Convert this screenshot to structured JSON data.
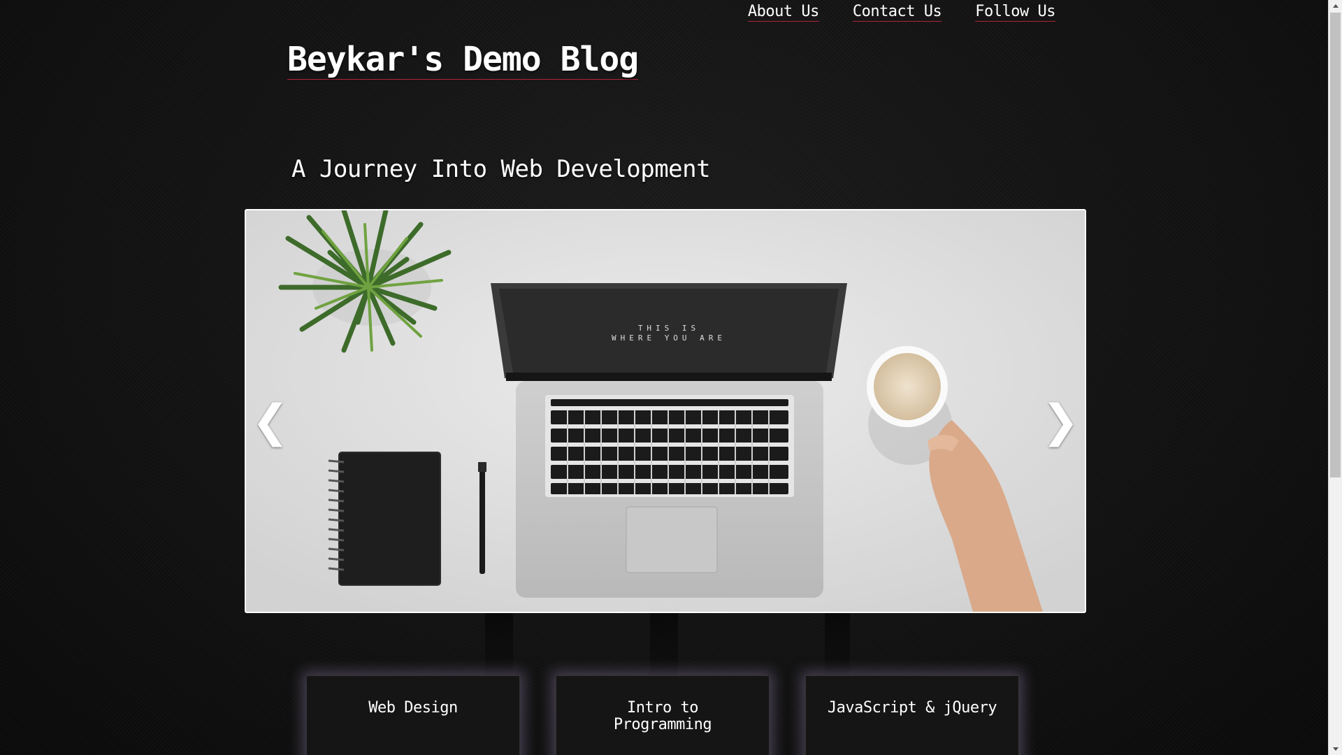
{
  "nav": {
    "items": [
      {
        "label": "About Us"
      },
      {
        "label": "Contact Us"
      },
      {
        "label": "Follow Us"
      }
    ]
  },
  "header": {
    "title": "Beykar's Demo Blog",
    "tagline": "A Journey Into Web Development"
  },
  "carousel": {
    "prev_glyph": "❮",
    "next_glyph": "❯",
    "screen_text_line1": "THIS IS",
    "screen_text_line2": "WHERE YOU ARE"
  },
  "cards": [
    {
      "title": "Web Design"
    },
    {
      "title": "Intro to Programming"
    },
    {
      "title": "JavaScript & jQuery"
    }
  ],
  "colors": {
    "accent_underline": "#b0253a",
    "background": "#111111",
    "card_glow": "#aa96c8"
  }
}
